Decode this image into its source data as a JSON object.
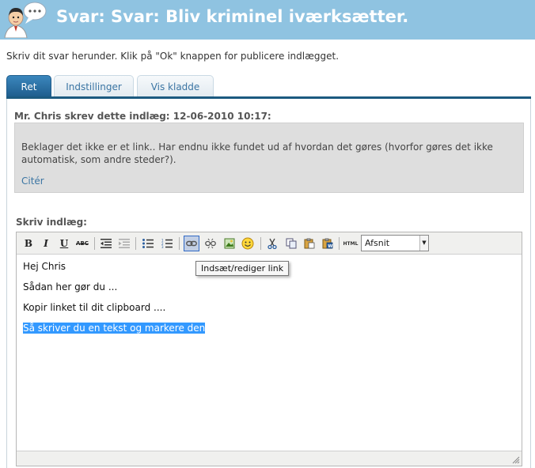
{
  "header": {
    "title": "Svar: Svar: Bliv kriminel iværksætter.",
    "background_color": "#8fc3e1",
    "icon": "user-chat-avatar-icon"
  },
  "instructions": "Skriv dit svar herunder. Klik på \"Ok\" knappen for publicere indlægget.",
  "tabs": [
    {
      "label": "Ret",
      "active": true
    },
    {
      "label": "Indstillinger",
      "active": false
    },
    {
      "label": "Vis kladde",
      "active": false
    }
  ],
  "quote": {
    "header": "Mr. Chris skrev dette indlæg: 12-06-2010 10:17:",
    "text": "Beklager det ikke er et link.. Har endnu ikke fundet ud af hvordan det gøres (hvorfor gøres det ikke automatisk, som andre steder?).",
    "cite_label": "Citér"
  },
  "editor": {
    "label": "Skriv indlæg:",
    "toolbar": {
      "bold": "B",
      "italic": "I",
      "underline": "U",
      "strikethrough": "ABC",
      "html": "HTML",
      "format_select": "Afsnit"
    },
    "tooltip": "Indsæt/rediger link",
    "lines": [
      "Hej Chris",
      "Sådan her gør du ...",
      "Kopir linket til dit clipboard ....",
      "Så skriver du en tekst og markere den"
    ],
    "selection_color": "#3399ff"
  }
}
